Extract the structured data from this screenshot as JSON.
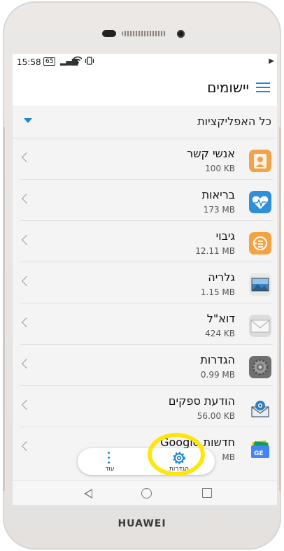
{
  "device": {
    "brand": "HUAWEI"
  },
  "status_bar": {
    "time": "15:58",
    "badge": "65"
  },
  "header": {
    "title": "יישומים"
  },
  "filter": {
    "label": "כל האפליקציות"
  },
  "apps": [
    {
      "name": "אנשי קשר",
      "size": "100 KB",
      "icon": "contacts-icon"
    },
    {
      "name": "בריאות",
      "size": "173 MB",
      "icon": "health-icon"
    },
    {
      "name": "גיבוי",
      "size": "12.11 MB",
      "icon": "backup-icon"
    },
    {
      "name": "גלריה",
      "size": "1.15 MB",
      "icon": "gallery-icon"
    },
    {
      "name": "דוא\"ל",
      "size": "424 KB",
      "icon": "email-icon"
    },
    {
      "name": "הגדרות",
      "size": "0.99 MB",
      "icon": "settings-icon"
    },
    {
      "name": "הודעת ספקים",
      "size": "56.00 KB",
      "icon": "provider-message-icon"
    },
    {
      "name": "חדשות Google",
      "size": "MB",
      "icon": "google-news-icon"
    }
  ],
  "bottom_actions": {
    "settings_label": "הגדרות",
    "more_label": "עוד"
  },
  "colors": {
    "accent": "#1f86d6",
    "highlight": "#ffe60a"
  }
}
